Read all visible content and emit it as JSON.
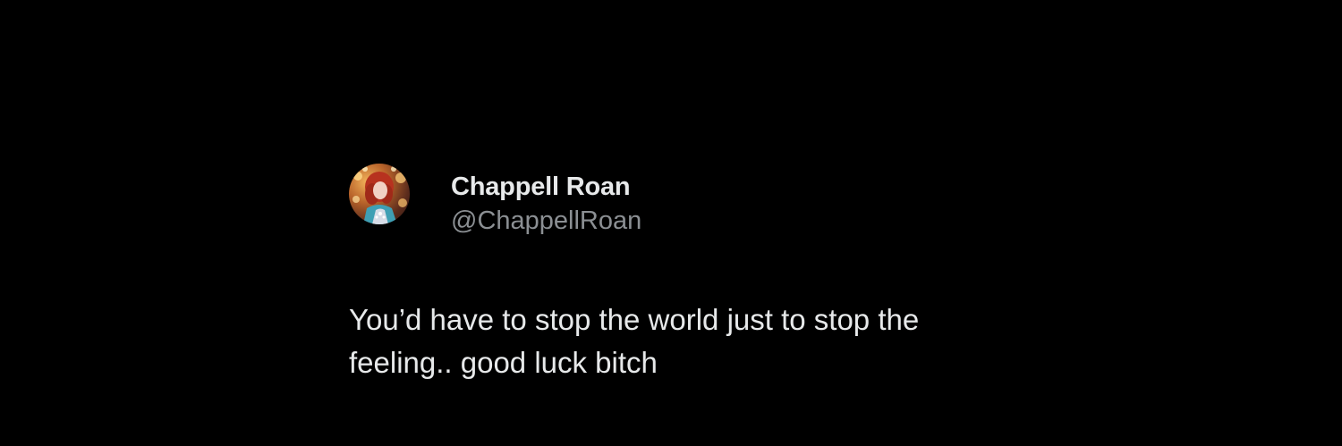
{
  "tweet": {
    "author_name": "Chappell Roan",
    "author_handle": "@ChappellRoan",
    "text_lines": [
      "You’d have to stop the world just to stop the",
      "feeling.. good luck bitch"
    ],
    "avatar_icon": "profile-photo-avatar"
  },
  "colors": {
    "background": "#000000",
    "primary_text": "#e7e9ea",
    "secondary_text": "#8b8f93"
  }
}
